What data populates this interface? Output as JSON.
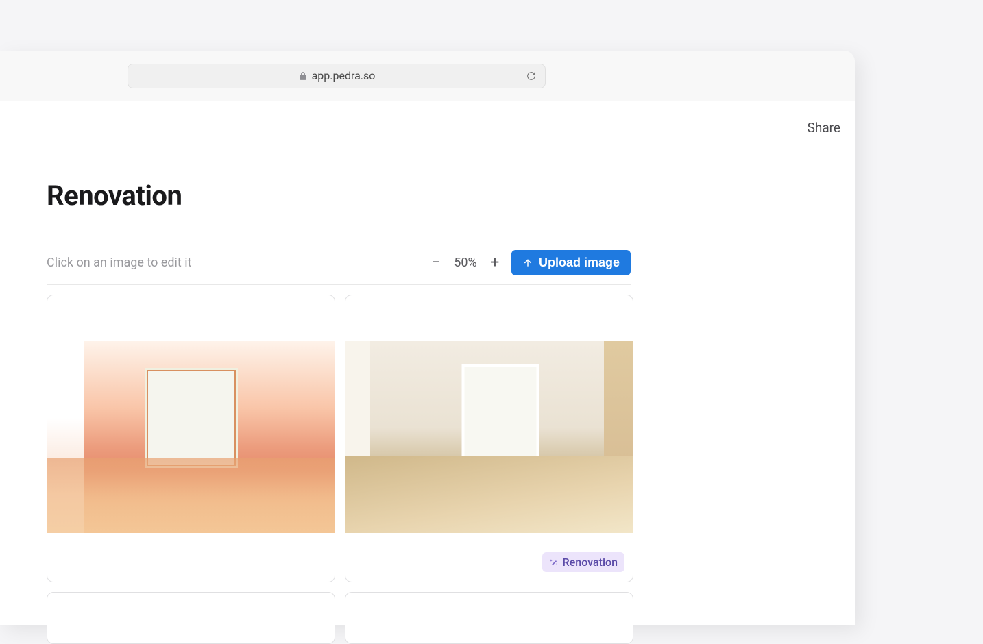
{
  "browser": {
    "url": "app.pedra.so"
  },
  "header": {
    "share_label": "Share"
  },
  "page": {
    "title": "Renovation",
    "hint": "Click on an image to edit it"
  },
  "toolbar": {
    "zoom_value": "50%",
    "upload_label": "Upload image"
  },
  "grid": {
    "cards": [
      {
        "badge": null
      },
      {
        "badge": "Renovation"
      }
    ]
  }
}
